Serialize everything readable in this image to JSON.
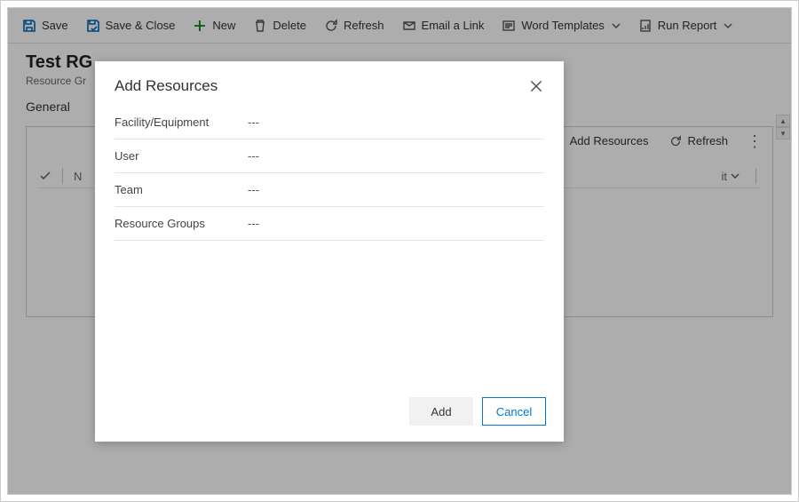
{
  "cmdbar": {
    "save": "Save",
    "save_close": "Save & Close",
    "new": "New",
    "delete": "Delete",
    "refresh": "Refresh",
    "email_link": "Email a Link",
    "word_templates": "Word Templates",
    "run_report": "Run Report"
  },
  "page": {
    "title": "Test RG",
    "subtitle": "Resource Gr",
    "tab_general": "General"
  },
  "subgrid": {
    "add_resources": "Add Resources",
    "refresh": "Refresh",
    "col_name": "N",
    "col_bu_suffix": "it"
  },
  "modal": {
    "title": "Add Resources",
    "fields": [
      {
        "label": "Facility/Equipment",
        "value": "---"
      },
      {
        "label": "User",
        "value": "---"
      },
      {
        "label": "Team",
        "value": "---"
      },
      {
        "label": "Resource Groups",
        "value": "---"
      }
    ],
    "add": "Add",
    "cancel": "Cancel"
  }
}
